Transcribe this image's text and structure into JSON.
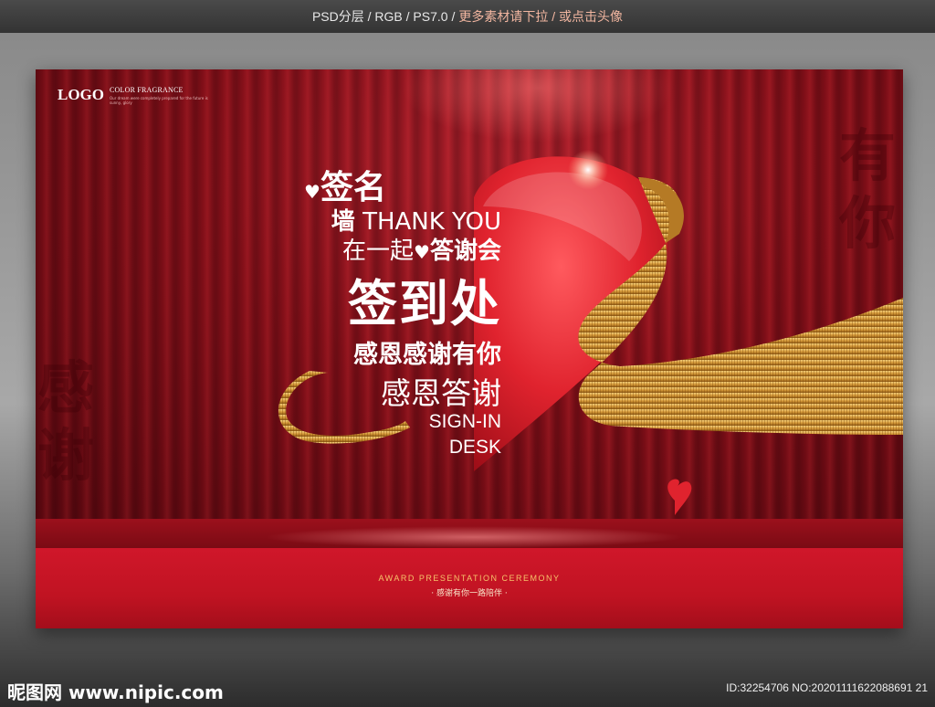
{
  "header": {
    "info": "PSD分层 / RGB / PS7.0 / ",
    "info_accent": "更多素材请下拉 / 或点击头像"
  },
  "poster": {
    "logo": "LOGO",
    "logo_sub_title": "COLOR FRAGRANCE",
    "logo_sub_small": "Our dream were completely prepared for the future is sunny, glory",
    "watermark_left": "感谢",
    "watermark_right": "有你",
    "line1": "签名",
    "line2_bold": "墙",
    "line2_rest": "THANK YOU",
    "line3_a": "在一起",
    "line3_b": "答谢会",
    "line4": "签到处",
    "line5": "感恩感谢有你",
    "line6": "感恩答谢",
    "line7": "SIGN-IN",
    "line8": "DESK",
    "award_title": "AWARD PRESENTATION CEREMONY",
    "award_sub": "· 感谢有你一路陪伴 ·"
  },
  "footer": {
    "site": "昵图网 www.nipic.com",
    "id": "ID:32254706 NO:20201111622088691 21"
  },
  "colors": {
    "poster_red": "#7b0f18",
    "stage_red": "#c01322",
    "ribbon_gold": "#d79a3a",
    "heart_red": "#e0232e"
  },
  "icons": [
    "heart-icon",
    "ribbon",
    "small-heart-icon"
  ]
}
